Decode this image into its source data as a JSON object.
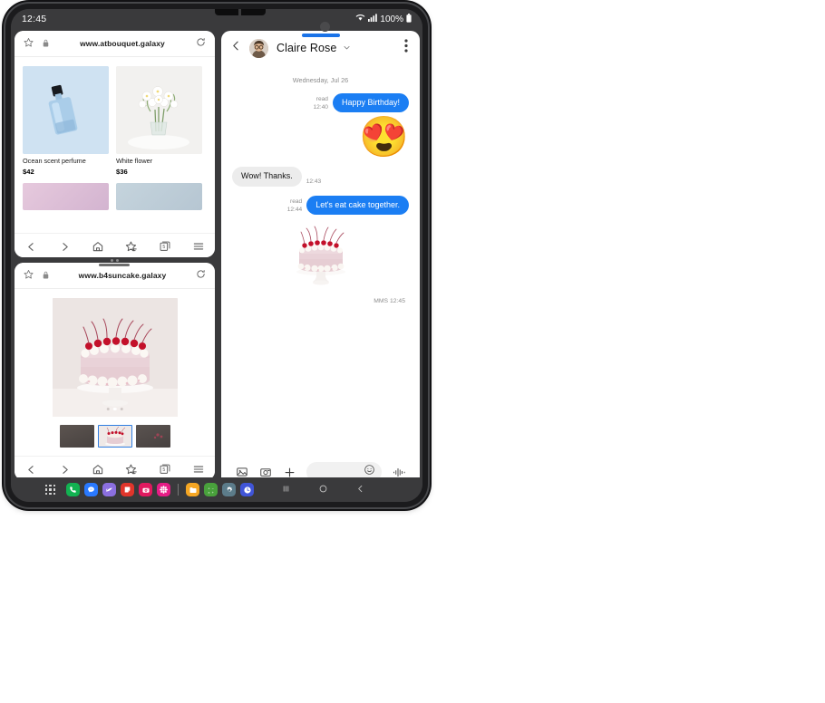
{
  "status_bar": {
    "clock": "12:45",
    "battery_text": "100%",
    "icons": [
      "wifi-icon",
      "signal-icon",
      "battery-icon"
    ]
  },
  "browser_window_1": {
    "url": "www.atbouquet.galaxy",
    "icons": {
      "bookmark": "star-icon",
      "lock": "lock-icon",
      "reload": "reload-icon"
    },
    "products": [
      {
        "name": "Ocean scent perfume",
        "price": "$42",
        "image": "perfume-bottle-blue"
      },
      {
        "name": "White flower",
        "price": "$36",
        "image": "white-flowers-vase"
      }
    ],
    "products_row2": [
      {
        "image": "pink-gradient-swatch"
      },
      {
        "image": "blue-gray-gradient-swatch"
      }
    ],
    "toolbar": {
      "back": "back-icon",
      "forward": "forward-icon",
      "home": "home-icon",
      "bookmarks": "bookmarks-icon",
      "tabs_count": "5",
      "menu": "menu-icon"
    }
  },
  "browser_window_2": {
    "url": "www.b4suncake.galaxy",
    "icons": {
      "bookmark": "star-icon",
      "lock": "lock-icon",
      "reload": "reload-icon"
    },
    "hero_image": "pink-cherry-cake-on-stand",
    "carousel_dots": 3,
    "carousel_active_index": 1,
    "thumbnails": [
      {
        "image": "cake-thumb-dark-1",
        "selected": false
      },
      {
        "image": "cake-thumb-pink-2",
        "selected": true
      },
      {
        "image": "cake-thumb-dark-3",
        "selected": false
      }
    ],
    "toolbar": {
      "back": "back-icon",
      "forward": "forward-icon",
      "home": "home-icon",
      "bookmarks": "bookmarks-icon",
      "tabs_count": "5",
      "menu": "menu-icon"
    }
  },
  "messages": {
    "header": {
      "contact_name": "Claire Rose",
      "back": "back-icon",
      "expand": "chevron-down-icon",
      "more": "more-options-icon",
      "avatar": "contact-avatar"
    },
    "day_separator": "Wednesday, Jul 26",
    "thread": [
      {
        "type": "text",
        "direction": "out",
        "text": "Happy Birthday!",
        "status": "read",
        "time": "12:40"
      },
      {
        "type": "emoji",
        "direction": "out",
        "emoji": "😍"
      },
      {
        "type": "text",
        "direction": "in",
        "text": "Wow! Thanks.",
        "time": "12:43"
      },
      {
        "type": "text",
        "direction": "out",
        "text": "Let's eat cake together.",
        "status": "read",
        "time": "12:44"
      },
      {
        "type": "mms",
        "direction": "out",
        "image": "pink-cherry-cake",
        "meta": "MMS 12:45"
      }
    ],
    "composer": {
      "gallery": "gallery-icon",
      "camera": "camera-icon",
      "add": "plus-icon",
      "input_placeholder": "",
      "input_value": "",
      "emoji": "emoji-icon",
      "voice": "voice-waveform-icon"
    }
  },
  "taskbar": {
    "apps_grid": "apps-grid-icon",
    "apps": [
      {
        "name": "phone-app",
        "color": "#12b251",
        "glyph": "✆"
      },
      {
        "name": "messages-app",
        "color": "#2979ff",
        "glyph": "💬"
      },
      {
        "name": "samsung-internet-app",
        "color": "#8b6fe0",
        "glyph": ""
      },
      {
        "name": "notes-app",
        "color": "#e0352b",
        "glyph": ""
      },
      {
        "name": "camera-app",
        "color": "#e0195f",
        "glyph": ""
      },
      {
        "name": "gallery-app",
        "color": "#e61d86",
        "glyph": "✽"
      },
      {
        "name": "divider",
        "color": "",
        "glyph": ""
      },
      {
        "name": "files-app",
        "color": "#f5a623",
        "glyph": ""
      },
      {
        "name": "calculator-app",
        "color": "#49a13c",
        "glyph": ""
      },
      {
        "name": "settings-app",
        "color": "#5c7c8a",
        "glyph": "⚙"
      },
      {
        "name": "clock-app",
        "color": "#4055d8",
        "glyph": "◕"
      }
    ],
    "nav": {
      "recents": "recents-icon",
      "home": "home-icon",
      "back": "back-icon"
    }
  }
}
